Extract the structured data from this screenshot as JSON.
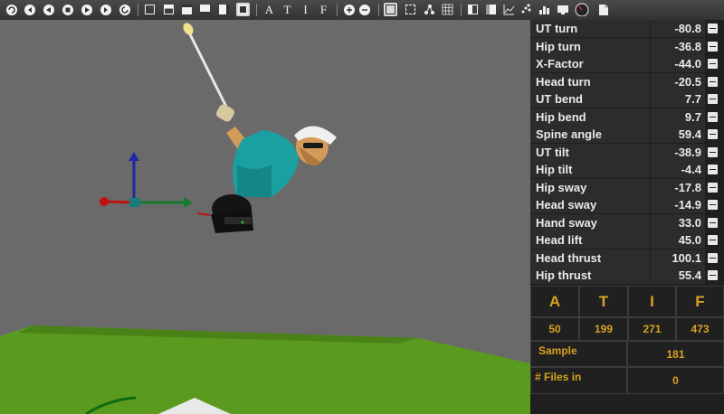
{
  "toolbar": {
    "icons": [
      "refresh-icon",
      "skip-back-icon",
      "play-back-icon",
      "stop-icon",
      "play-icon",
      "skip-forward-icon",
      "loop-icon",
      "view-single-icon",
      "view-split-icon",
      "view-top-icon",
      "view-side-icon",
      "view-front-icon",
      "view-active-icon",
      "zoom-in-icon",
      "zoom-out-icon",
      "layout-icon",
      "fit-icon",
      "nodes-icon",
      "grid-icon",
      "panel-icon",
      "panel-split-icon",
      "graph-icon",
      "scatter-icon",
      "chart-icon",
      "screen-icon",
      "gauge-icon",
      "export-icon"
    ],
    "letters": [
      "A",
      "T",
      "I",
      "F"
    ]
  },
  "metrics": [
    {
      "label": "UT turn",
      "value": "-80.8"
    },
    {
      "label": "Hip turn",
      "value": "-36.8"
    },
    {
      "label": "X-Factor",
      "value": "-44.0"
    },
    {
      "label": "Head turn",
      "value": "-20.5"
    },
    {
      "label": "UT bend",
      "value": "7.7"
    },
    {
      "label": "Hip bend",
      "value": "9.7"
    },
    {
      "label": "Spine angle",
      "value": "59.4"
    },
    {
      "label": "UT tilt",
      "value": "-38.9"
    },
    {
      "label": "Hip tilt",
      "value": "-4.4"
    },
    {
      "label": "Hip sway",
      "value": "-17.8"
    },
    {
      "label": "Head sway",
      "value": "-14.9"
    },
    {
      "label": "Hand sway",
      "value": "33.0"
    },
    {
      "label": "Head lift",
      "value": "45.0"
    },
    {
      "label": "Head thrust",
      "value": "100.1"
    },
    {
      "label": "Hip thrust",
      "value": "55.4"
    }
  ],
  "atif": {
    "headers": [
      "A",
      "T",
      "I",
      "F"
    ],
    "values": [
      "50",
      "199",
      "271",
      "473"
    ]
  },
  "sample": {
    "label": "Sample",
    "value": "181"
  },
  "files": {
    "label": "# Files in",
    "value": "0"
  },
  "colors": {
    "accent": "#d6a31e",
    "panel": "#1f1f1f",
    "grass": "#5a9a1e"
  }
}
